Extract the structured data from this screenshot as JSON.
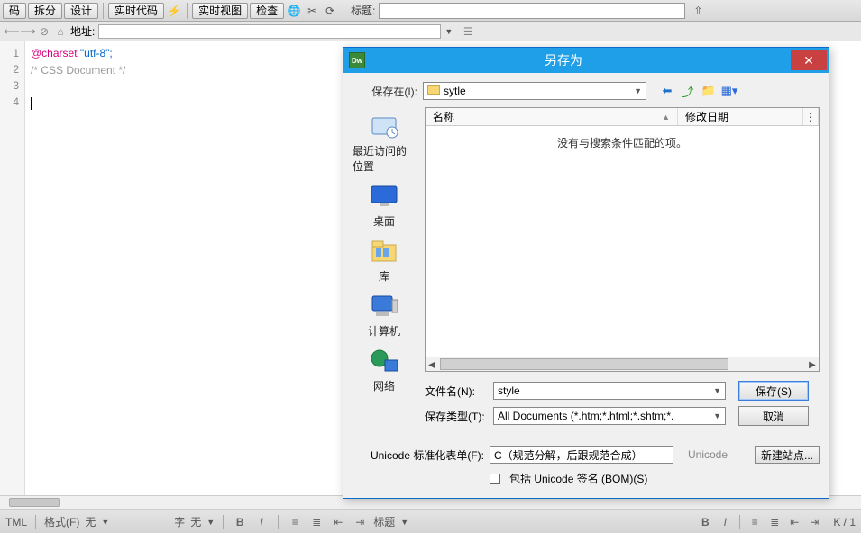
{
  "toolbar": {
    "btn_code": "码",
    "btn_split": "拆分",
    "btn_design": "设计",
    "btn_livecode": "实时代码",
    "btn_liveview": "实时视图",
    "btn_inspect": "检查",
    "title_label": "标题:",
    "title_value": ""
  },
  "addressbar": {
    "label": "地址:",
    "value": ""
  },
  "editor": {
    "lines": [
      "1",
      "2",
      "3",
      "4"
    ],
    "line1_directive": "@charset",
    "line1_value": " \"utf-8\";",
    "line2": "/* CSS Document */"
  },
  "status": {
    "left1": "TML",
    "fmt_label": "格式(F)",
    "fmt_value": "无",
    "font_label": "字",
    "font_value": "无",
    "right_info": "K / 1"
  },
  "dialog": {
    "title": "另存为",
    "save_in_label": "保存在(I):",
    "save_in_value": "sytle",
    "places": {
      "recent": "最近访问的位置",
      "desktop": "桌面",
      "library": "库",
      "computer": "计算机",
      "network": "网络"
    },
    "columns": {
      "name": "名称",
      "date": "修改日期"
    },
    "empty_msg": "没有与搜索条件匹配的项。",
    "filename_label": "文件名(N):",
    "filename_value": "style",
    "filetype_label": "保存类型(T):",
    "filetype_value": "All Documents (*.htm;*.html;*.shtm;*.",
    "save_btn": "保存(S)",
    "cancel_btn": "取消",
    "unicode_label": "Unicode 标准化表单(F):",
    "unicode_value": "C（规范分解，后跟规范合成）",
    "unicode_hint": "Unicode",
    "bom_label": "包括 Unicode 签名 (BOM)(S)",
    "newsite_btn": "新建站点..."
  }
}
